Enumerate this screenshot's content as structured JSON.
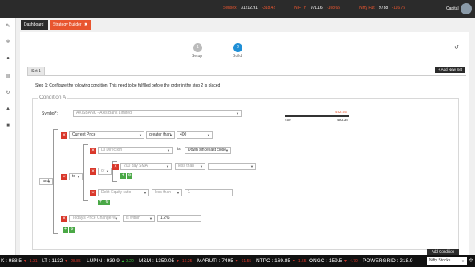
{
  "topbar": {
    "indices": [
      {
        "name": "Sensex",
        "value": "31212.91",
        "change": "-318.42"
      },
      {
        "name": "NIFTY",
        "value": "9711.6",
        "change": "-108.65"
      },
      {
        "name": "Nifty Fut",
        "value": "9738",
        "change": "-116.75"
      }
    ],
    "user_label": "Capital"
  },
  "sidebar": {
    "icons": [
      "wrench-icon",
      "gear-icon",
      "circle-icon",
      "clipboard-icon",
      "refresh-icon",
      "flask-icon",
      "briefcase-icon"
    ]
  },
  "tabs": [
    {
      "label": "Dashboard"
    },
    {
      "label": "Strategy Builder",
      "close": "✖"
    }
  ],
  "steps": [
    {
      "number": "1",
      "label": "Setup"
    },
    {
      "number": "2",
      "label": "Build"
    }
  ],
  "set_tab": "Set 1",
  "add_new_set": "+ Add New Set",
  "instruction": "Step 1: Configure the following condition. This need to be fulfilled before the order in the step 2 is placed",
  "condition": {
    "title": "Condition A",
    "symbol_label": "Symbol*:",
    "symbol_value": "AXISBANK - Axis Bank Limited",
    "range": {
      "current": "492.05",
      "low": "450",
      "high": "493.35"
    },
    "outer_logic": "and",
    "rows": [
      {
        "field": "Current Price",
        "op": "greater than",
        "value": "400"
      },
      {
        "field": "DI Direction",
        "op": "is",
        "value": "Down since last close"
      },
      {
        "field": "200 day SMA",
        "op": "less than",
        "value": ""
      },
      {
        "field": "Debt-Equity ratio",
        "op": "less than",
        "value": "1"
      },
      {
        "field": "Today's Price Change %",
        "op": "is within",
        "value": "1.2%"
      }
    ],
    "group_logic": "to",
    "inner_logic": "or"
  },
  "add_condition": "Add Condition",
  "ticker": {
    "items": [
      {
        "name": "K",
        "value": "988.5",
        "change": "▼ -1.31"
      },
      {
        "name": "LT",
        "value": "1132",
        "change": "▼ -28.85"
      },
      {
        "name": "LUPIN",
        "value": "939.9",
        "change": "▲ 3.20"
      },
      {
        "name": "M&M",
        "value": "1350.05",
        "change": "▼ -16.25"
      },
      {
        "name": "MARUTI",
        "value": "7495",
        "change": "▼ -61.55"
      },
      {
        "name": "NTPC",
        "value": "169.85",
        "change": "▼ -1.55"
      },
      {
        "name": "ONGC",
        "value": "159.5",
        "change": "▼ -4.70"
      },
      {
        "name": "POWERGRID",
        "value": "218.9",
        "change": ""
      }
    ],
    "selector": "Nifty Stocks"
  }
}
